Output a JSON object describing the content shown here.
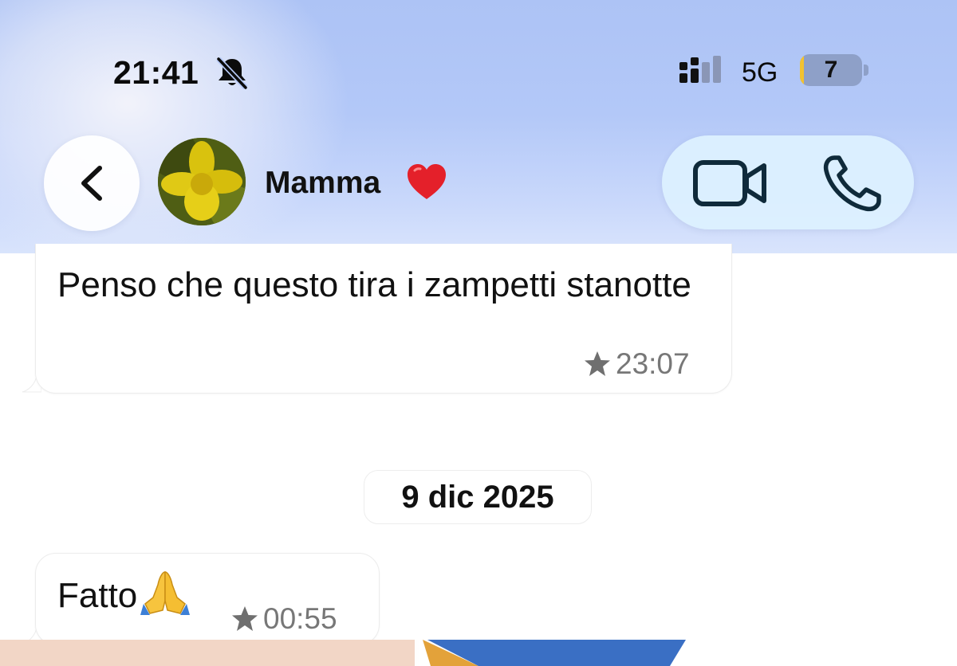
{
  "status_bar": {
    "time": "21:41",
    "network": "5G",
    "battery_level": "7",
    "battery_fraction": 0.07,
    "icons": [
      "bell-slash-icon",
      "signal-bars-icon"
    ]
  },
  "nav": {
    "contact_name": "Mamma",
    "contact_emoji_icon": "red-heart-icon",
    "avatar_icon": "yellow-flower-photo",
    "back_icon": "chevron-left-icon",
    "video_icon": "video-camera-icon",
    "call_icon": "phone-icon"
  },
  "messages": [
    {
      "text": "Penso che questo  tira i zampetti stanotte",
      "time": "23:07",
      "starred": true
    },
    {
      "text": "Fatto",
      "emoji_icon": "folded-hands-icon",
      "time": "00:55",
      "starred": true
    }
  ],
  "date_separator": "9 dic 2025",
  "colors": {
    "header_blue": "#b3c8f8",
    "call_pill": "#dcf0ff",
    "meta_gray": "#777777",
    "battery_fill": "#f2c230"
  }
}
